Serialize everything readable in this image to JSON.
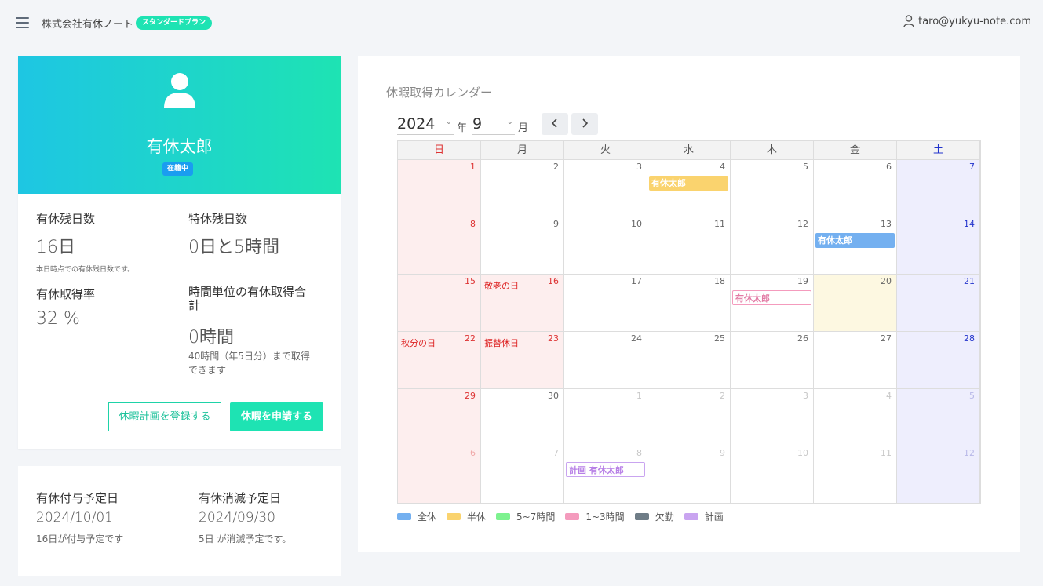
{
  "header": {
    "company": "株式会社有休ノート",
    "plan": "スタンダードプラン",
    "user_email": "taro@yukyu-note.com"
  },
  "profile": {
    "name": "有休太郎",
    "status": "在籍中",
    "paid_remaining_label": "有休残日数",
    "paid_remaining_value": "16日",
    "paid_remaining_note": "本日時点での有休残日数です。",
    "special_remaining_label": "特休残日数",
    "special_remaining_value": "0日と5時間",
    "rate_label": "有休取得率",
    "rate_value": "32 %",
    "hourly_label_line1": "時間単位の有休取得合",
    "hourly_label_line2": "計",
    "hourly_value": "0時間",
    "hourly_note_line1": "40時間（年5日分）まで取得",
    "hourly_note_line2": "できます",
    "register_plan_button": "休暇計画を登録する",
    "apply_button": "休暇を申請する"
  },
  "grant": {
    "grant_label": "有休付与予定日",
    "grant_date": "2024/10/01",
    "grant_note": "16日が付与予定です",
    "expire_label": "有休消滅予定日",
    "expire_date": "2024/09/30",
    "expire_note": "5日 が消滅予定です。"
  },
  "calendar": {
    "title": "休暇取得カレンダー",
    "year": "2024",
    "year_unit": "年",
    "month": "9",
    "month_unit": "月",
    "weekdays": [
      "日",
      "月",
      "火",
      "水",
      "木",
      "金",
      "土"
    ],
    "weeks": [
      [
        {
          "d": "1"
        },
        {
          "d": "2"
        },
        {
          "d": "3"
        },
        {
          "d": "4",
          "event": {
            "label": "有休太郎",
            "kind": "half"
          }
        },
        {
          "d": "5"
        },
        {
          "d": "6"
        },
        {
          "d": "7"
        }
      ],
      [
        {
          "d": "8"
        },
        {
          "d": "9"
        },
        {
          "d": "10"
        },
        {
          "d": "11"
        },
        {
          "d": "12"
        },
        {
          "d": "13",
          "event": {
            "label": "有休太郎",
            "kind": "full"
          }
        },
        {
          "d": "14"
        }
      ],
      [
        {
          "d": "15"
        },
        {
          "d": "16",
          "holiday": "敬老の日"
        },
        {
          "d": "17"
        },
        {
          "d": "18"
        },
        {
          "d": "19",
          "event": {
            "label": "有休太郎",
            "kind": "hour13"
          }
        },
        {
          "d": "20",
          "today": true
        },
        {
          "d": "21"
        }
      ],
      [
        {
          "d": "22",
          "holiday": "秋分の日"
        },
        {
          "d": "23",
          "holiday": "振替休日"
        },
        {
          "d": "24"
        },
        {
          "d": "25"
        },
        {
          "d": "26"
        },
        {
          "d": "27"
        },
        {
          "d": "28"
        }
      ],
      [
        {
          "d": "29"
        },
        {
          "d": "30"
        },
        {
          "d": "1",
          "other": true
        },
        {
          "d": "2",
          "other": true
        },
        {
          "d": "3",
          "other": true
        },
        {
          "d": "4",
          "other": true
        },
        {
          "d": "5",
          "other": true
        }
      ],
      [
        {
          "d": "6",
          "other": true
        },
        {
          "d": "7",
          "other": true
        },
        {
          "d": "8",
          "other": true,
          "event": {
            "label": "計画 有休太郎",
            "kind": "plan"
          }
        },
        {
          "d": "9",
          "other": true
        },
        {
          "d": "10",
          "other": true
        },
        {
          "d": "11",
          "other": true
        },
        {
          "d": "12",
          "other": true
        }
      ]
    ],
    "legend": [
      {
        "label": "全休",
        "color": "#74b0f0"
      },
      {
        "label": "半休",
        "color": "#fad36e"
      },
      {
        "label": "5~7時間",
        "color": "#7df28f"
      },
      {
        "label": "1~3時間",
        "color": "#f49bbd"
      },
      {
        "label": "欠勤",
        "color": "#6f7d87"
      },
      {
        "label": "計画",
        "color": "#c9a4f0"
      }
    ],
    "colors": {
      "sunday_text": "#dd3333",
      "saturday_text": "#2233cc",
      "sunday_bg": "#fdeeee",
      "saturday_bg": "#eeeefd",
      "today_bg": "#fdf8e1"
    }
  }
}
